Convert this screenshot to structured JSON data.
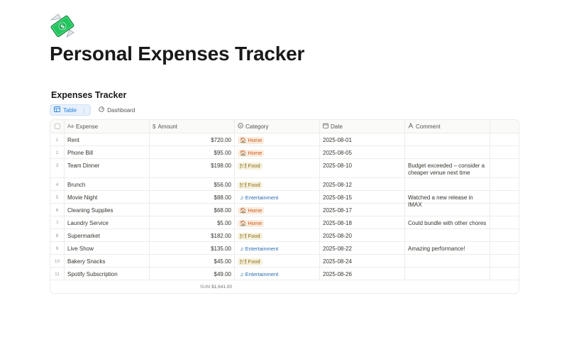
{
  "page": {
    "icon": "money-with-wings-icon",
    "title": "Personal Expenses Tracker"
  },
  "database": {
    "title": "Expenses Tracker",
    "views": [
      {
        "label": "Table",
        "icon": "table-icon",
        "active": true
      },
      {
        "label": "Dashboard",
        "icon": "dashboard-icon",
        "active": false
      }
    ],
    "columns": [
      {
        "label": "Expense",
        "icon": "text-icon"
      },
      {
        "label": "Amount",
        "icon": "dollar-icon"
      },
      {
        "label": "Category",
        "icon": "select-icon"
      },
      {
        "label": "Date",
        "icon": "calendar-icon"
      },
      {
        "label": "Comment",
        "icon": "text-a-icon"
      }
    ],
    "rows": [
      {
        "n": "1",
        "expense": "Rent",
        "amount": "$720.00",
        "category": "Home",
        "date": "2025-08-01",
        "comment": ""
      },
      {
        "n": "2",
        "expense": "Phone Bill",
        "amount": "$95.00",
        "category": "Home",
        "date": "2025-08-05",
        "comment": ""
      },
      {
        "n": "3",
        "expense": "Team Dinner",
        "amount": "$198.00",
        "category": "Food",
        "date": "2025-08-10",
        "comment": "Budget exceeded – consider a cheaper venue next time"
      },
      {
        "n": "4",
        "expense": "Brunch",
        "amount": "$56.00",
        "category": "Food",
        "date": "2025-08-12",
        "comment": ""
      },
      {
        "n": "5",
        "expense": "Movie Night",
        "amount": "$88.00",
        "category": "Entertainment",
        "date": "2025-08-15",
        "comment": "Watched a new release in IMAX"
      },
      {
        "n": "6",
        "expense": "Cleaning Supplies",
        "amount": "$68.00",
        "category": "Home",
        "date": "2025-08-17",
        "comment": ""
      },
      {
        "n": "7",
        "expense": "Laundry Service",
        "amount": "$5.00",
        "category": "Home",
        "date": "2025-08-18",
        "comment": "Could bundle with other chores"
      },
      {
        "n": "8",
        "expense": "Supermarket",
        "amount": "$182.00",
        "category": "Food",
        "date": "2025-08-20",
        "comment": ""
      },
      {
        "n": "9",
        "expense": "Live Show",
        "amount": "$135.00",
        "category": "Entertainment",
        "date": "2025-08-22",
        "comment": "Amazing performance!"
      },
      {
        "n": "10",
        "expense": "Bakery Snacks",
        "amount": "$45.00",
        "category": "Food",
        "date": "2025-08-24",
        "comment": ""
      },
      {
        "n": "11",
        "expense": "Spotify Subscription",
        "amount": "$49.00",
        "category": "Entertainment",
        "date": "2025-08-26",
        "comment": ""
      }
    ],
    "footer": {
      "sum_label": "SUM",
      "sum_value": "$1,641.00"
    },
    "category_styles": {
      "Home": {
        "icon": "house-icon",
        "glyph": "🏠",
        "class": "tag-home"
      },
      "Food": {
        "icon": "fork-knife-icon",
        "glyph": "🍽",
        "class": "tag-food"
      },
      "Entertainment": {
        "icon": "music-note-icon",
        "glyph": "♫",
        "class": "tag-ent"
      }
    }
  },
  "colors": {
    "accent": "#2383e2",
    "home_tag_bg": "#fbecdd",
    "food_tag_bg": "#f6f1dc",
    "entertainment_text": "#2b6cb0"
  }
}
